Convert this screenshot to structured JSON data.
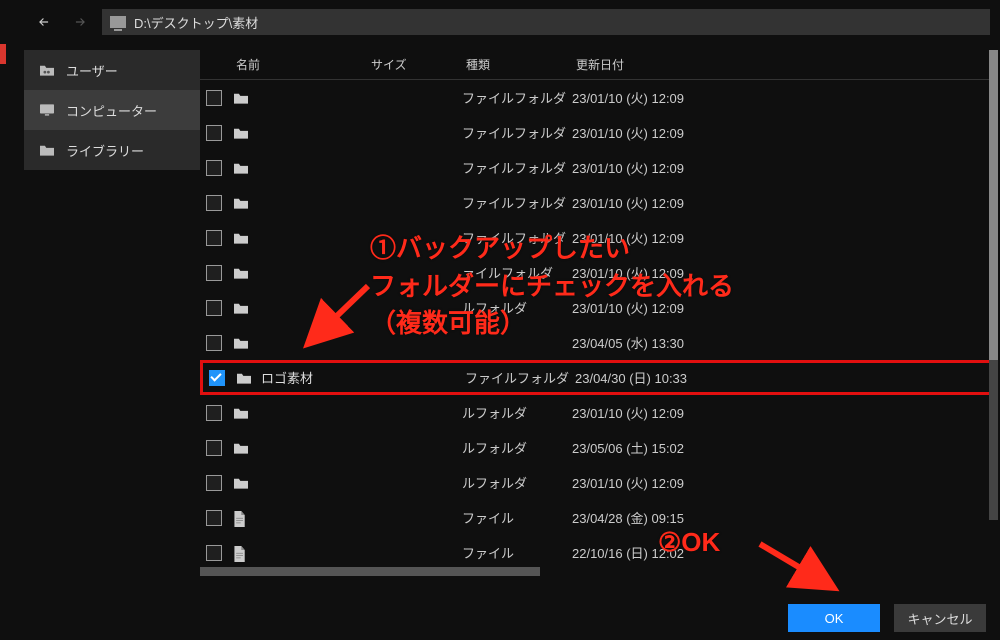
{
  "topbar": {
    "path_text": "D:\\デスクトップ\\素材"
  },
  "sidebar": {
    "items": [
      {
        "label": "ユーザー",
        "icon": "users-folder-icon",
        "selected": false
      },
      {
        "label": "コンピューター",
        "icon": "monitor-icon",
        "selected": true
      },
      {
        "label": "ライブラリー",
        "icon": "folder-icon",
        "selected": false
      }
    ]
  },
  "columns": {
    "name": "名前",
    "size": "サイズ",
    "type": "種類",
    "modified": "更新日付"
  },
  "rows": [
    {
      "checked": false,
      "icon": "folder",
      "name": "",
      "type": "ファイルフォルダ",
      "modified": "23/01/10 (火) 12:09"
    },
    {
      "checked": false,
      "icon": "folder",
      "name": "",
      "type": "ファイルフォルダ",
      "modified": "23/01/10 (火) 12:09"
    },
    {
      "checked": false,
      "icon": "folder",
      "name": "",
      "type": "ファイルフォルダ",
      "modified": "23/01/10 (火) 12:09"
    },
    {
      "checked": false,
      "icon": "folder",
      "name": "",
      "type": "ファイルフォルダ",
      "modified": "23/01/10 (火) 12:09"
    },
    {
      "checked": false,
      "icon": "folder",
      "name": "",
      "type": "ファイルフォルダ",
      "modified": "23/01/10 (火) 12:09"
    },
    {
      "checked": false,
      "icon": "folder",
      "name": "",
      "type": "ァイルフォルダ",
      "modified": "23/01/10 (火) 12:09"
    },
    {
      "checked": false,
      "icon": "folder",
      "name": "",
      "type": "ルフォルダ",
      "modified": "23/01/10 (火) 12:09"
    },
    {
      "checked": false,
      "icon": "folder",
      "name": "",
      "type": "",
      "modified": "23/04/05 (水) 13:30"
    },
    {
      "checked": true,
      "icon": "folder",
      "name": "ロゴ素材",
      "type": "ファイルフォルダ",
      "modified": "23/04/30 (日) 10:33",
      "highlight": true
    },
    {
      "checked": false,
      "icon": "folder",
      "name": "",
      "type": "ルフォルダ",
      "modified": "23/01/10 (火) 12:09"
    },
    {
      "checked": false,
      "icon": "folder",
      "name": "",
      "type": "ルフォルダ",
      "modified": "23/05/06 (土) 15:02"
    },
    {
      "checked": false,
      "icon": "folder",
      "name": "",
      "type": "ルフォルダ",
      "modified": "23/01/10 (火) 12:09"
    },
    {
      "checked": false,
      "icon": "file",
      "name": "",
      "type": "ファイル",
      "modified": "23/04/28 (金) 09:15"
    },
    {
      "checked": false,
      "icon": "file",
      "name": "",
      "type": "ファイル",
      "modified": "22/10/16 (日) 12:02"
    }
  ],
  "footer": {
    "ok": "OK",
    "cancel": "キャンセル"
  },
  "annotations": {
    "line1": "①バックアップしたい",
    "line2": "フォルダーにチェックを入れる",
    "line3": "（複数可能）",
    "ok_label": "②OK"
  }
}
